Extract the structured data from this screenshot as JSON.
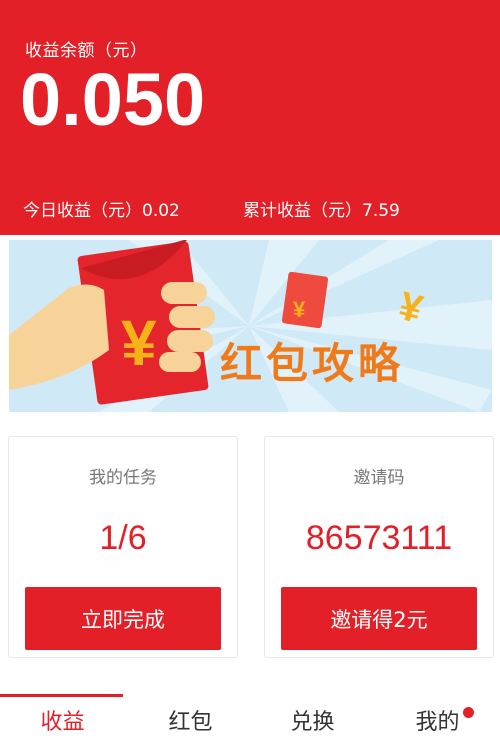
{
  "header": {
    "balance_label": "收益余额（元）",
    "balance_value": "0.050",
    "today_label": "今日收益（元）0.02",
    "total_label": "累计收益（元）7.59"
  },
  "banner": {
    "title": "红包攻略"
  },
  "cards": {
    "task": {
      "title": "我的任务",
      "value": "1/6",
      "button": "立即完成"
    },
    "invite": {
      "title": "邀请码",
      "value": "86573111",
      "button": "邀请得2元"
    }
  },
  "tabbar": {
    "tabs": [
      "收益",
      "红包",
      "兑换",
      "我的"
    ],
    "active_index": 0
  },
  "colors": {
    "primary_red": "#e32028",
    "banner_bg": "#cfe9f7",
    "banner_text": "#f07a1a"
  }
}
